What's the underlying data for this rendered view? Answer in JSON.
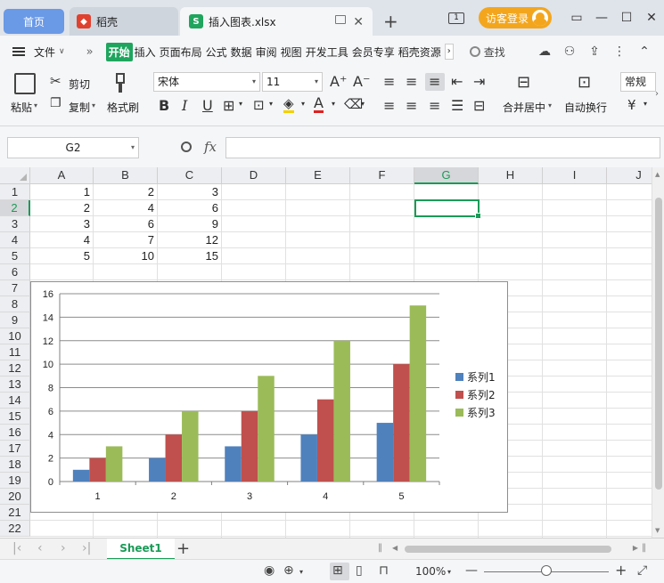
{
  "titlebar": {
    "home_tab": "首页",
    "daoke_tab": "稻壳",
    "doc_tab": "插入图表.xlsx",
    "badge": "1",
    "visitor_login": "访客登录"
  },
  "menu": {
    "file": "文件",
    "more": "»",
    "tabs": [
      "开始",
      "插入",
      "页面布局",
      "公式",
      "数据",
      "审阅",
      "视图",
      "开发工具",
      "会员专享",
      "稻壳资源"
    ],
    "search": "查找"
  },
  "ribbon": {
    "paste": "粘贴",
    "cut": "剪切",
    "copy": "复制",
    "format_painter": "格式刷",
    "font_name": "宋体",
    "font_size": "11",
    "merge_center": "合并居中",
    "wrap_text": "自动换行",
    "number_format": "常规",
    "currency": "¥",
    "bold": "B",
    "italic": "I",
    "underline": "U",
    "font_color": "A",
    "increase_font": "A⁺",
    "decrease_font": "A⁻"
  },
  "formula_bar": {
    "cell_ref": "G2",
    "fx": "fx",
    "value": ""
  },
  "grid": {
    "columns": [
      "A",
      "B",
      "C",
      "D",
      "E",
      "F",
      "G",
      "H",
      "I",
      "J"
    ],
    "rows": [
      "1",
      "2",
      "3",
      "4",
      "5",
      "6",
      "7",
      "8",
      "9",
      "10",
      "11",
      "12",
      "13",
      "14",
      "15",
      "16",
      "17",
      "18",
      "19",
      "20",
      "21",
      "22"
    ],
    "active_col": "G",
    "active_row": "2",
    "cells": [
      [
        "1",
        "2",
        "3"
      ],
      [
        "2",
        "4",
        "6"
      ],
      [
        "3",
        "6",
        "9"
      ],
      [
        "4",
        "7",
        "12"
      ],
      [
        "5",
        "10",
        "15"
      ]
    ]
  },
  "chart_data": {
    "type": "bar",
    "categories": [
      "1",
      "2",
      "3",
      "4",
      "5"
    ],
    "series": [
      {
        "name": "系列1",
        "values": [
          1,
          2,
          3,
          4,
          5
        ],
        "color": "#4f81bd"
      },
      {
        "name": "系列2",
        "values": [
          2,
          4,
          6,
          7,
          10
        ],
        "color": "#c0504d"
      },
      {
        "name": "系列3",
        "values": [
          3,
          6,
          9,
          12,
          15
        ],
        "color": "#9bbb59"
      }
    ],
    "ylim": [
      0,
      16
    ],
    "yticks": [
      "0",
      "2",
      "4",
      "6",
      "8",
      "10",
      "12",
      "14",
      "16"
    ],
    "grid": true,
    "legend": "right"
  },
  "sheets": {
    "tabs": [
      "Sheet1"
    ],
    "add": "+"
  },
  "status": {
    "zoom": "100%",
    "zoom_fraction": 0.5
  }
}
